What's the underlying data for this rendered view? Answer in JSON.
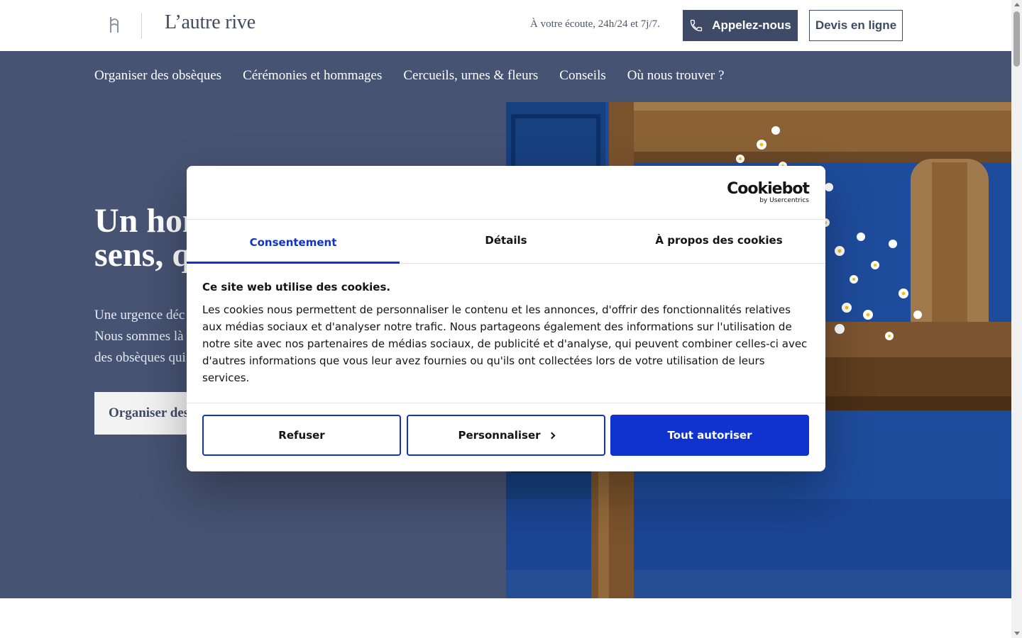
{
  "header": {
    "brand": "L’autre rive",
    "ecoute": "À votre écoute, 24h/24 et 7j/7.",
    "call_label": "Appelez-nous",
    "devis_label": "Devis en ligne",
    "icons": {
      "logo": "brand-logo-icon",
      "phone": "phone-icon"
    }
  },
  "nav": {
    "items": [
      {
        "label": "Organiser des obsèques"
      },
      {
        "label": "Cérémonies et hommages"
      },
      {
        "label": "Cercueils, urnes & fleurs"
      },
      {
        "label": "Conseils"
      },
      {
        "label": "Où nous trouver ?"
      }
    ]
  },
  "hero": {
    "title_line1": "Un hon",
    "title_line2": "sens, q",
    "text_line1": "Une urgence déc",
    "text_line2": "Nous sommes là",
    "text_line3": "des obsèques qui",
    "button_label": "Organiser des",
    "image": "daisy-bouquet-on-wooden-bench-photo"
  },
  "cookie": {
    "logo_main": "Cookiebot",
    "logo_sub": "by Usercentrics",
    "tabs": [
      {
        "label": "Consentement",
        "active": true
      },
      {
        "label": "Détails",
        "active": false
      },
      {
        "label": "À propos des cookies",
        "active": false
      }
    ],
    "heading": "Ce site web utilise des cookies.",
    "text": "Les cookies nous permettent de personnaliser le contenu et les annonces, d'offrir des fonctionnalités relatives aux médias sociaux et d'analyser notre trafic. Nous partageons également des informations sur l'utilisation de notre site avec nos partenaires de médias sociaux, de publicité et d'analyse, qui peuvent combiner celles-ci avec d'autres informations que vous leur avez fournies ou qu'ils ont collectées lors de votre utilisation de leurs services.",
    "buttons": {
      "refuse": "Refuser",
      "customize": "Personnaliser",
      "allow": "Tout autoriser"
    }
  },
  "colors": {
    "brand_navy": "#475372",
    "brand_text": "#3f4a66",
    "cookie_accent": "#1032cf"
  }
}
